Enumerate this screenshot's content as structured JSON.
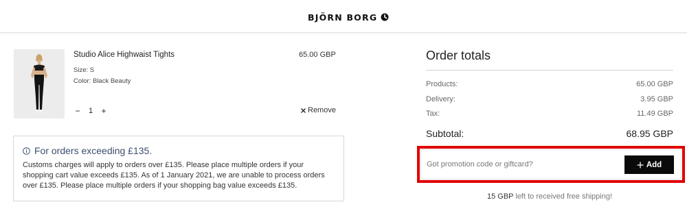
{
  "header": {
    "brand": "BJÖRN BORG"
  },
  "cart_item": {
    "name": "Studio Alice Highwaist Tights",
    "price": "65.00 GBP",
    "size": "Size: S",
    "color": "Color: Black Beauty",
    "quantity": "1",
    "decrease_label": "−",
    "increase_label": "+",
    "remove_label": "Remove",
    "remove_icon": "close-icon"
  },
  "notice": {
    "title": "For orders exceeding £135.",
    "body": "Customs charges will apply to orders over £135. Please place multiple orders if your shopping cart value exceeds £135. As of 1 January 2021, we are unable to process orders over £135. Please place multiple orders if your shopping bag value exceeds £135.",
    "icon": "info-icon"
  },
  "totals": {
    "title": "Order totals",
    "rows": [
      {
        "label": "Products:",
        "value": "65.00 GBP"
      },
      {
        "label": "Delivery:",
        "value": "3.95 GBP"
      },
      {
        "label": "Tax:",
        "value": "11.49 GBP"
      }
    ],
    "subtotal_label": "Subtotal:",
    "subtotal_value": "68.95 GBP"
  },
  "promo": {
    "placeholder": "Got promotion code or giftcard?",
    "value": "",
    "button_label": "Add",
    "button_icon": "plus-icon"
  },
  "shipping": {
    "amount": "15 GBP",
    "text": " left to received free shipping!"
  },
  "colors": {
    "highlight": "#e00000",
    "button_bg": "#0a0a0a",
    "notice_title": "#3b4f6e"
  }
}
